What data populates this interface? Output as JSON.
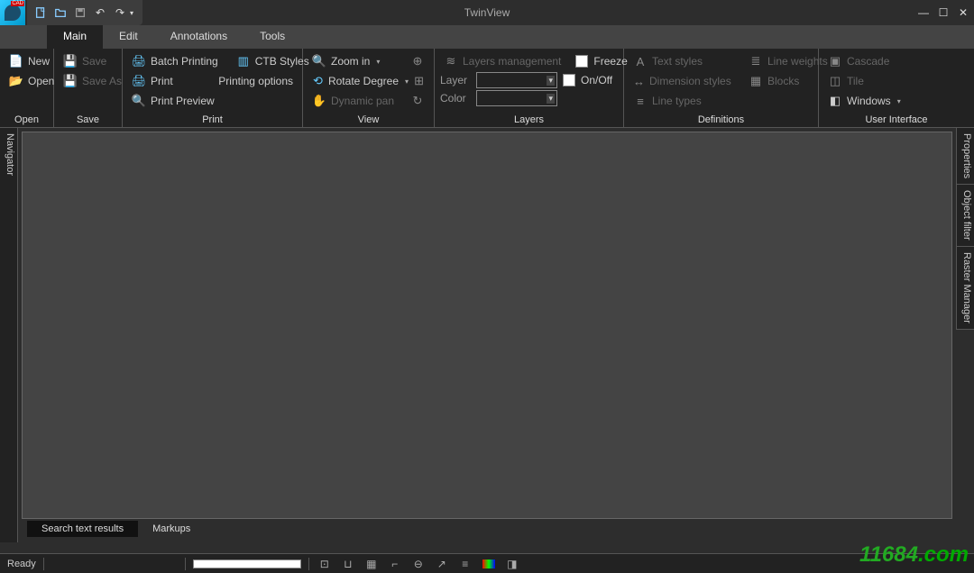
{
  "title": "TwinView",
  "tabs": {
    "main": "Main",
    "edit": "Edit",
    "annotations": "Annotations",
    "tools": "Tools"
  },
  "ribbon": {
    "open": {
      "new": "New",
      "open": "Open",
      "label": "Open"
    },
    "save": {
      "save": "Save",
      "saveas": "Save As",
      "label": "Save"
    },
    "print": {
      "batch": "Batch Printing",
      "ctb": "CTB Styles",
      "print": "Print",
      "options": "Printing options",
      "preview": "Print Preview",
      "label": "Print"
    },
    "view": {
      "zoomin": "Zoom in",
      "rotate": "Rotate Degree",
      "pan": "Dynamic pan",
      "label": "View"
    },
    "layers": {
      "mgmt": "Layers management",
      "freeze": "Freeze",
      "layer": "Layer",
      "onoff": "On/Off",
      "color": "Color",
      "label": "Layers"
    },
    "definitions": {
      "textstyles": "Text styles",
      "lineweights": "Line weights",
      "dimstyles": "Dimension styles",
      "blocks": "Blocks",
      "linetypes": "Line types",
      "label": "Definitions"
    },
    "ui": {
      "cascade": "Cascade",
      "tile": "Tile",
      "windows": "Windows",
      "label": "User Interface"
    }
  },
  "side": {
    "navigator": "Navigator",
    "properties": "Properties",
    "objectfilter": "Object filter",
    "raster": "Raster Manager"
  },
  "bottom_tabs": {
    "search": "Search text results",
    "markups": "Markups"
  },
  "status": "Ready",
  "watermark": {
    "num": "11684",
    "dom": ".com"
  }
}
